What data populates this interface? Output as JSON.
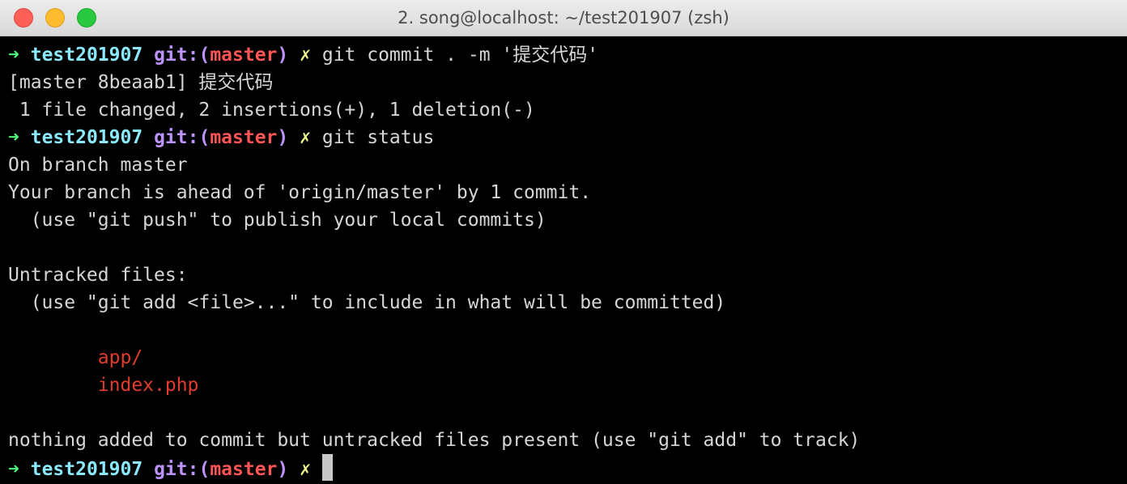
{
  "window": {
    "title": "2. song@localhost: ~/test201907 (zsh)"
  },
  "prompt": {
    "arrow": "➜",
    "dir": "test201907",
    "git_prefix": "git:(",
    "branch": "master",
    "git_suffix": ")",
    "dirty": "✗"
  },
  "lines": {
    "cmd1": "git commit . -m '提交代码'",
    "commit_result": "[master 8beaab1] 提交代码",
    "commit_stats": " 1 file changed, 2 insertions(+), 1 deletion(-)",
    "cmd2": "git status",
    "on_branch": "On branch master",
    "ahead": "Your branch is ahead of 'origin/master' by 1 commit.",
    "push_hint": "  (use \"git push\" to publish your local commits)",
    "untracked_header": "Untracked files:",
    "add_hint": "  (use \"git add <file>...\" to include in what will be committed)",
    "untracked_files": [
      "app/",
      "index.php"
    ],
    "nothing_added": "nothing added to commit but untracked files present (use \"git add\" to track)"
  },
  "colors": {
    "background": "#000000",
    "text": "#d6d6d6",
    "arrow": "#50fa7b",
    "dir": "#8be9fd",
    "git": "#bd93f9",
    "branch": "#ff5555",
    "dirty": "#f1fa8c",
    "untracked": "#e23c2f"
  },
  "icons": [
    "close-button",
    "minimize-button",
    "zoom-button"
  ]
}
